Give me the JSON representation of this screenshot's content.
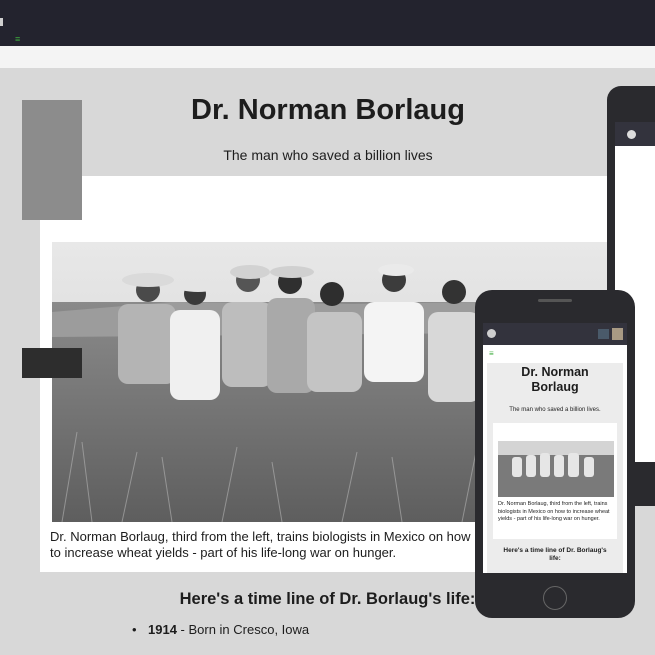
{
  "page": {
    "title": "Dr. Norman Borlaug",
    "subtitle": "The man who saved a billion lives",
    "caption": "Dr. Norman Borlaug, third from the left, trains biologists in Mexico on how to increase wheat yields - part of his life-long war on hunger.",
    "timeline_heading": "Here's a time line of Dr. Borlaug's life:",
    "timeline": [
      {
        "year": "1914",
        "event": " - Born in Cresco, Iowa"
      }
    ]
  },
  "phone": {
    "title": "Dr. Norman Borlaug",
    "subtitle": "The man who saved a billion lives.",
    "caption": "Dr. Norman Borlaug, third from the left, trains biologists in Mexico on how to increase wheat yields - part of his life-long war on hunger.",
    "timeline_heading": "Here's a time line of Dr. Borlaug's life:"
  },
  "icons": {
    "menu": "hamburger-menu-icon",
    "profile": "profile-icon",
    "home": "home-button"
  },
  "colors": {
    "topbar": "#23232e",
    "menu_accent": "#3cab3c",
    "background": "#d8d8d8"
  }
}
